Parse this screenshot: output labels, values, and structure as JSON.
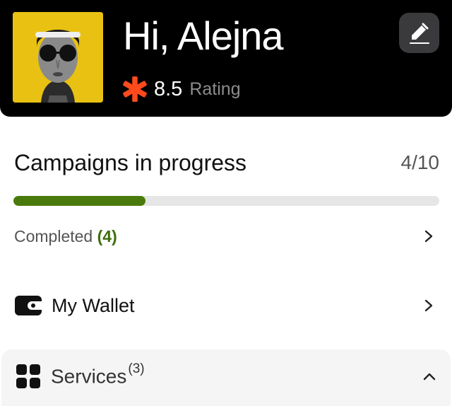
{
  "header": {
    "greeting": "Hi, Alejna",
    "rating_value": "8.5",
    "rating_label": "Rating",
    "avatar_bg_color": "#e8c113",
    "star_color": "#ff4a1c"
  },
  "campaigns": {
    "title": "Campaigns in progress",
    "count": "4/10",
    "progress": 0.31,
    "progress_color": "#4a7a0c",
    "completed_label": "Completed",
    "completed_count": "(4)"
  },
  "wallet": {
    "label": "My Wallet"
  },
  "services": {
    "label": "Services",
    "count": "(3)"
  },
  "icons": {
    "edit": "pencil-icon",
    "rating": "star-icon",
    "chevron_right": "chevron-right-icon",
    "chevron_up": "chevron-up-icon",
    "wallet": "wallet-icon",
    "services": "grid-icon"
  }
}
